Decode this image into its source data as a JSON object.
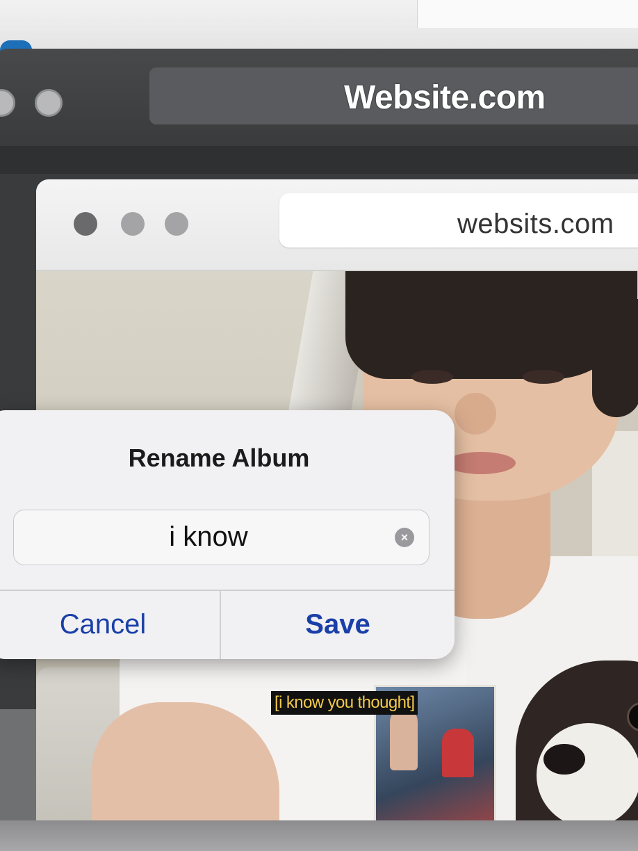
{
  "outer_browser": {
    "url": "Website.com"
  },
  "inner_browser": {
    "url": "websits.com"
  },
  "video": {
    "caption": "[i know you thought]"
  },
  "dialog": {
    "title": "Rename Album",
    "input_value": "i know",
    "cancel_label": "Cancel",
    "save_label": "Save"
  },
  "colors": {
    "accent_blue": "#1a3fa8",
    "caption_text": "#f2c94c",
    "caption_bg": "#111111"
  },
  "icons": {
    "clear": "clear-icon"
  }
}
